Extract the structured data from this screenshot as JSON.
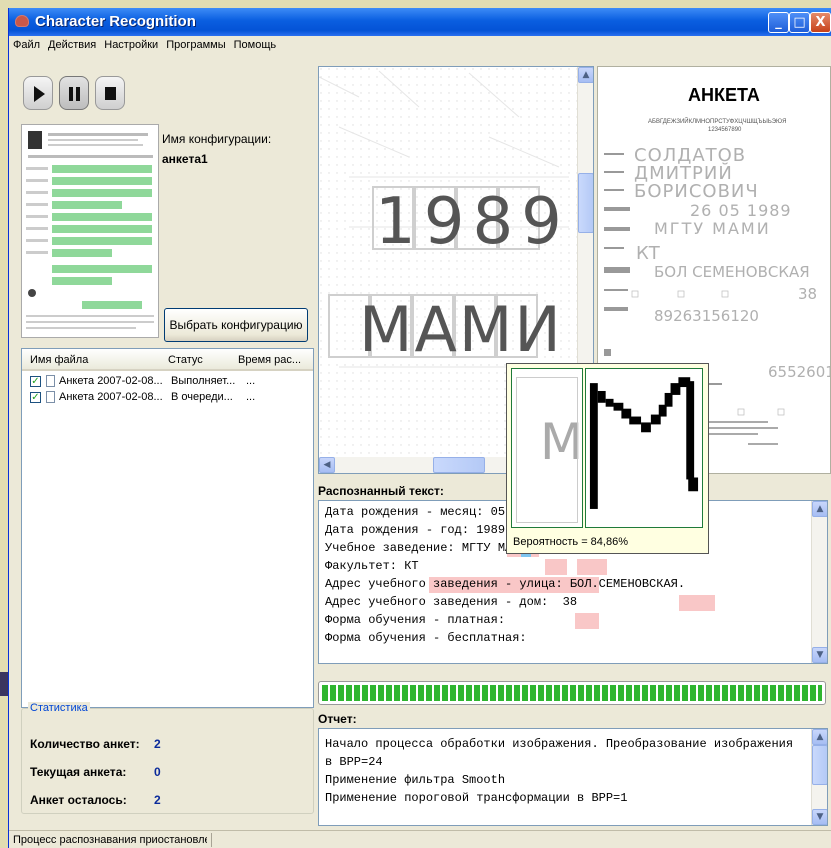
{
  "window": {
    "title": "Character Recognition",
    "buttons": {
      "minimize": "_",
      "maximize": "□",
      "close": "X"
    }
  },
  "menu": [
    "Файл",
    "Действия",
    "Настройки",
    "Программы",
    "Помощь"
  ],
  "config": {
    "label": "Имя конфигурации:",
    "name": "анкета1",
    "choose_button": "Выбрать конфигурацию"
  },
  "file_list": {
    "columns": [
      "Имя файла",
      "Статус",
      "Время рас..."
    ],
    "rows": [
      {
        "checked": "✓",
        "name": "Анкета 2007-02-08...",
        "status": "Выполняет...",
        "time": "..."
      },
      {
        "checked": "✓",
        "name": "Анкета 2007-02-08...",
        "status": "В очереди...",
        "time": "..."
      }
    ]
  },
  "stats": {
    "legend": "Статистика",
    "rows": [
      {
        "label": "Количество анкет:",
        "value": "2"
      },
      {
        "label": "Текущая анкета:",
        "value": "0"
      },
      {
        "label": "Анкет осталось:",
        "value": "2"
      }
    ]
  },
  "scan_text": {
    "year": "1989",
    "word": "МАМИ"
  },
  "form_preview": {
    "title": "АНКЕТА",
    "alphabet": "АБВГДЕЖЗИЙКЛМНОПРСТУФХЦЧШЩЪЫЬЭЮЯ",
    "digits": "1234567890",
    "fields": [
      "СОЛДАТОВ",
      "ДМИТРИЙ",
      "БОРИСОВИЧ",
      "26 05 1989",
      "МГТУ МАМИ",
      "КТ",
      "БОЛ СЕМЕНОВСКАЯ",
      "38",
      "89263156120",
      "6552601"
    ]
  },
  "recognized": {
    "label": "Распознанный текст:",
    "lines": [
      "Дата рождения - месяц: 05",
      "Дата рождения - год: 1989",
      "Учебное заведение: МГТУ МАМИ",
      "Факультет: КТ",
      "Адрес учебного заведения - улица: БОЛ.СЕМЕНОВСКАЯ.",
      "Адрес учебного заведения - дом:  38",
      "Форма обучения - платная:",
      "Форма обучения - бесплатная:"
    ]
  },
  "popup": {
    "probability": "Вероятность = 84,86%",
    "glyph": "М"
  },
  "progress": {
    "value": 1.0
  },
  "report": {
    "label": "Отчет:",
    "lines": [
      "Начало процесса обработки изображения. Преобразование изображения",
      "в BPP=24",
      "Применение фильтра Smooth",
      "Применение пороговой трансформации в BPP=1"
    ]
  },
  "status": "Процесс распознавания приостановлен"
}
